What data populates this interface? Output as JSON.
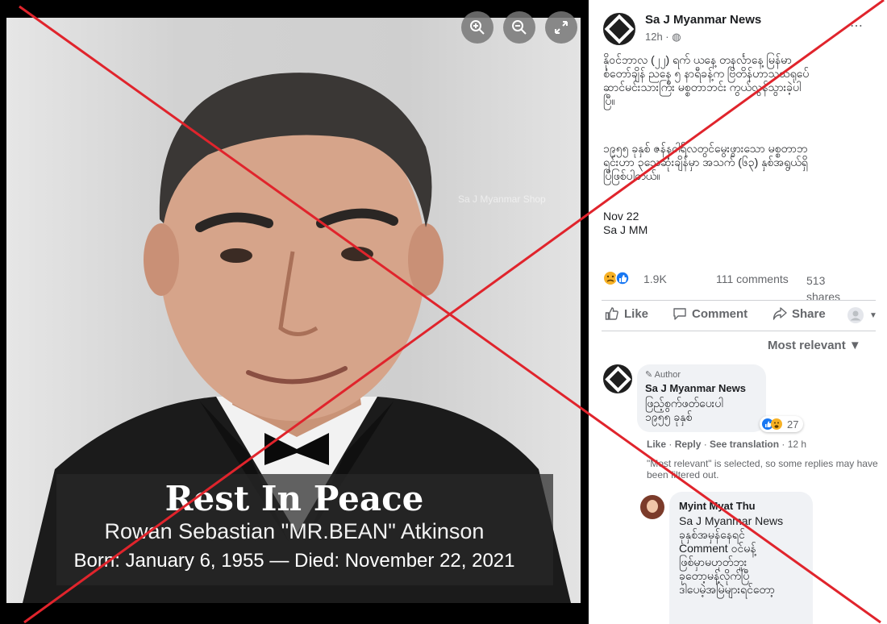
{
  "viewer": {
    "zoom_in_icon": "zoom-in-icon",
    "zoom_out_icon": "zoom-out-icon",
    "fullscreen_icon": "fullscreen-icon",
    "watermark": "Sa J Myanmar Shop",
    "caption": {
      "title": "Rest In Peace",
      "name": "Rowan Sebastian \"MR.BEAN\" Atkinson",
      "dates": "Born: January 6, 1955  — Died: November 22,  2021"
    }
  },
  "post": {
    "page_name": "Sa J Myanmar News",
    "time": "12h · ",
    "body_p1": "နိုဝင်ဘာလ (၂၂) ရက် ယနေ့ တနင်္လာနေ့ မြန်မာ\nစံတော်ချိန် ညနေ ၅ နာရီခန့်က ဗြိတိန်ဟာသသရုပ်ေ\nဆာင်မင်းသားကြီး မစ္စတာဘင်း ကွယ်လွန်သွားခဲ့ပါ\nပြီ။",
    "body_p2": "၁၉၅၅ ခုနှစ် ဇန်နဝါရီလတွင်မွေးဖွားသော မစ္စတာဘ\nရင်းဟာ ၃သေဆုံးချိန်မှာ အသက် (၆၃) နှစ်အရွယ်ရှိ\nပြီဖြစ်ပါတယ်။",
    "body_p3": "Nov 22\nSa J MM",
    "reaction_count": "1.9K",
    "comments_count": "111 comments",
    "shares_count": "513 shares",
    "actions": {
      "like": "Like",
      "comment": "Comment",
      "share": "Share"
    },
    "sort_label": "Most relevant ▼"
  },
  "comments": [
    {
      "badge": "Author",
      "name": "Sa J Myanmar News",
      "text": "ဖြည့်စွက်ဖတ်ပေးပါ\n၁၉၅၅ ခုနှစ်",
      "reaction_count": "27",
      "like": "Like",
      "reply": "Reply",
      "translate": "See translation",
      "time": "12 h"
    },
    {
      "name": "Myint Myat Thu",
      "text": "Sa J Myanmar News\nခုနှစ်အမှန်နေရင်\nComment ဝင်မန့်\nဖြစ်မှာမဟုတ်ဘူး\nခုတော့မန့်လိုက်ပြီ\nဒါပေမဲ့အမြဲများရင်တော့"
    }
  ],
  "notice": "\"Most relevant\" is selected, so some replies may have been filtered out.",
  "colors": {
    "accent": "#1877f2",
    "cross": "#e0242c",
    "viewer_bg": "#000000"
  }
}
